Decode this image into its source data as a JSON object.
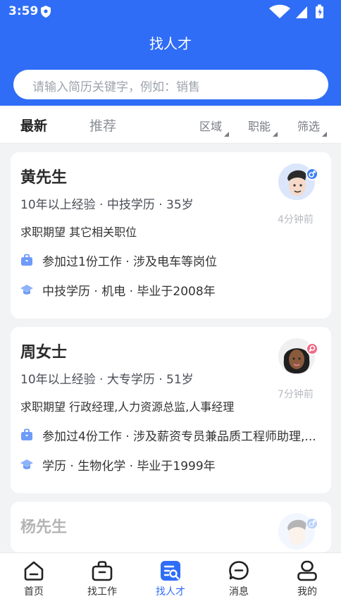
{
  "status": {
    "time": "3:59"
  },
  "header": {
    "title": "找人才"
  },
  "search": {
    "placeholder": "请输入简历关键字，例如：销售"
  },
  "tabs": {
    "latest": "最新",
    "recommend": "推荐"
  },
  "filters": {
    "region": "区域",
    "function": "职能",
    "screen": "筛选"
  },
  "cards": [
    {
      "name": "黄先生",
      "summary": "10年以上经验 · 中技学历 · 35岁",
      "expect": "求职期望 其它相关职位",
      "work": "参加过1份工作 · 涉及电车等岗位",
      "edu": "中技学历 · 机电 · 毕业于2008年",
      "time": "4分钟前",
      "gender": "male"
    },
    {
      "name": "周女士",
      "summary": "10年以上经验 · 大专学历 · 51岁",
      "expect": "求职期望 行政经理,人力资源总监,人事经理",
      "work": "参加过4份工作 · 涉及薪资专员兼品质工程师助理,...",
      "edu": "学历 · 生物化学 · 毕业于1999年",
      "time": "7分钟前",
      "gender": "female"
    },
    {
      "name": "杨先生",
      "gender": "male"
    }
  ],
  "tabbar": [
    {
      "label": "首页"
    },
    {
      "label": "找工作"
    },
    {
      "label": "找人才"
    },
    {
      "label": "消息"
    },
    {
      "label": "我的"
    }
  ],
  "colors": {
    "primary": "#2f6df6",
    "male": "#3d7ff5",
    "female": "#f06b84"
  }
}
